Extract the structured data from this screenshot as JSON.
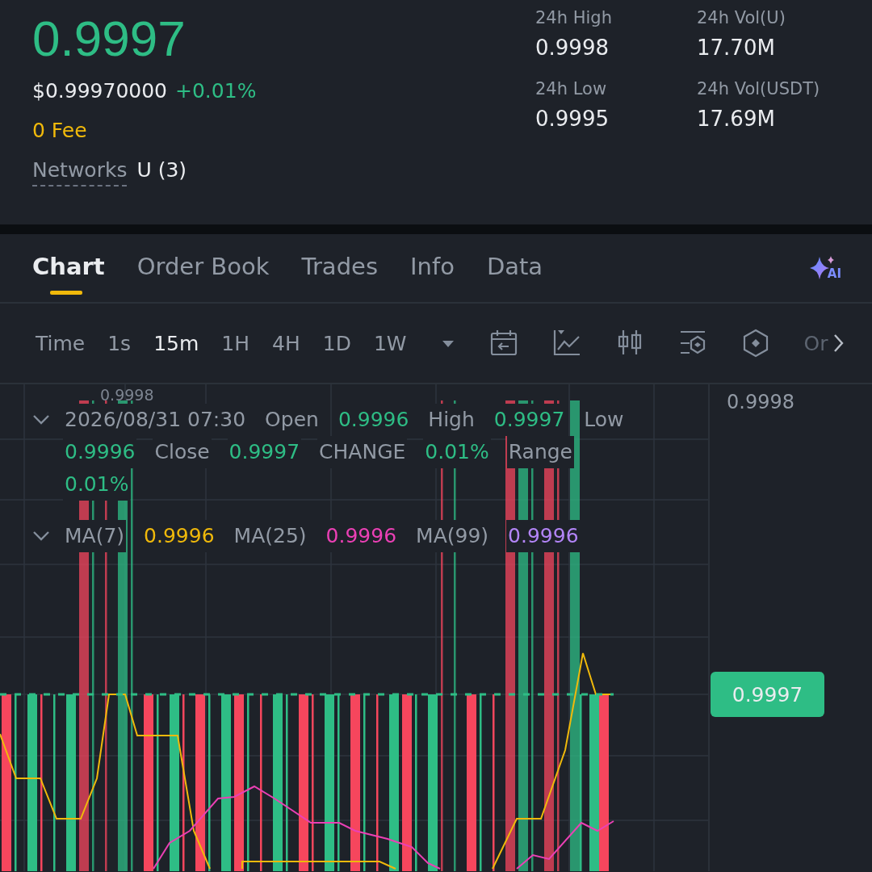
{
  "ticker": {
    "price": "0.9997",
    "fiat_price": "$0.99970000",
    "change": "+0.01%",
    "fee": "0 Fee",
    "networks_label": "Networks",
    "networks_value": "U (3)"
  },
  "stats": [
    {
      "label": "24h High",
      "value": "0.9998"
    },
    {
      "label": "24h Vol(U)",
      "value": "17.70M"
    },
    {
      "label": "24h Low",
      "value": "0.9995"
    },
    {
      "label": "24h Vol(USDT)",
      "value": "17.69M"
    }
  ],
  "tabs": [
    {
      "label": "Chart",
      "selected": true
    },
    {
      "label": "Order Book",
      "selected": false
    },
    {
      "label": "Trades",
      "selected": false
    },
    {
      "label": "Info",
      "selected": false
    },
    {
      "label": "Data",
      "selected": false
    }
  ],
  "ai_label": "AI",
  "toolbar": {
    "label": "Time",
    "more": "Or",
    "intervals": [
      {
        "label": "1s",
        "selected": false
      },
      {
        "label": "15m",
        "selected": true
      },
      {
        "label": "1H",
        "selected": false
      },
      {
        "label": "4H",
        "selected": false
      },
      {
        "label": "1D",
        "selected": false
      },
      {
        "label": "1W",
        "selected": false
      }
    ]
  },
  "chart": {
    "max_marker": "0.9998",
    "axis_label": "0.9998",
    "last_price": "0.9997",
    "legends": [
      {
        "expanded": true,
        "items": [
          {
            "kind": "label",
            "text": "2026/08/31 07:30"
          },
          {
            "kind": "label",
            "text": "Open"
          },
          {
            "kind": "value",
            "text": "0.9996"
          },
          {
            "kind": "label",
            "text": "High"
          },
          {
            "kind": "value",
            "text": "0.9997"
          },
          {
            "kind": "label",
            "text": "Low"
          },
          {
            "kind": "value",
            "text": "0.9996"
          },
          {
            "kind": "label",
            "text": "Close"
          },
          {
            "kind": "value",
            "text": "0.9997"
          },
          {
            "kind": "label",
            "text": "CHANGE"
          },
          {
            "kind": "value",
            "text": "0.01%"
          },
          {
            "kind": "label",
            "text": "Range"
          },
          {
            "kind": "value",
            "text": "0.01%"
          }
        ]
      },
      {
        "expanded": true,
        "items": [
          {
            "kind": "label",
            "text": "MA(7)"
          },
          {
            "kind": "value",
            "text": "0.9996",
            "color": "#f0b90b"
          },
          {
            "kind": "label",
            "text": "MA(25)"
          },
          {
            "kind": "value",
            "text": "0.9996",
            "color": "#eb40b5"
          },
          {
            "kind": "label",
            "text": "MA(99)"
          },
          {
            "kind": "value",
            "text": "0.9996",
            "color": "#b385f8"
          }
        ]
      }
    ]
  }
}
